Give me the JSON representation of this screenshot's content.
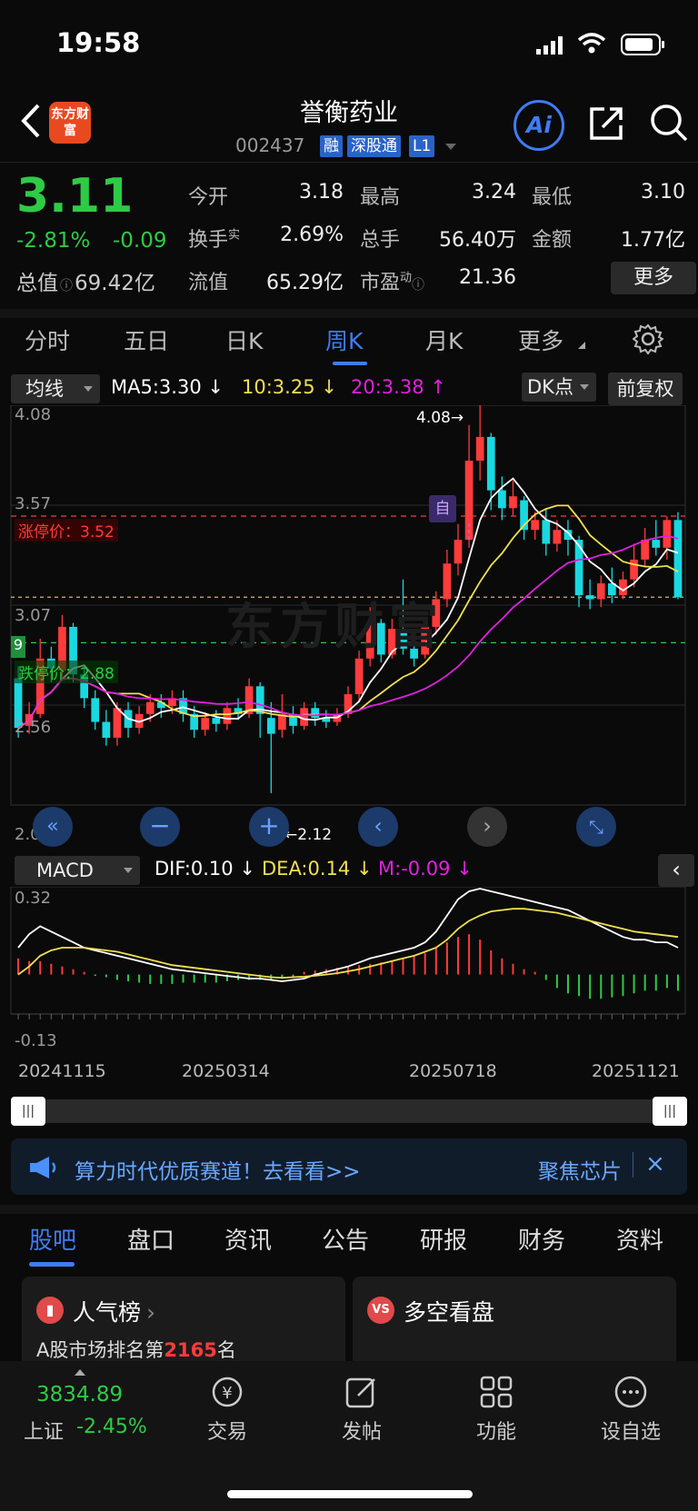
{
  "status_bar": {
    "time": "19:58"
  },
  "header": {
    "app_logo": "东方财富",
    "stock_name": "誉衡药业",
    "stock_code": "002437",
    "tags": [
      "融",
      "深股通",
      "L1"
    ],
    "ai_label": "Ai"
  },
  "quote": {
    "price": "3.11",
    "pct_change": "-2.81%",
    "change": "-0.09",
    "total_value_label": "总值",
    "total_value": "69.42亿",
    "fields": [
      {
        "label": "今开",
        "value": "3.18",
        "color": "green"
      },
      {
        "label": "最高",
        "value": "3.24",
        "color": "red"
      },
      {
        "label": "最低",
        "value": "3.10",
        "color": "green"
      },
      {
        "label": "换手",
        "sup": "实",
        "value": "2.69%",
        "color": "white"
      },
      {
        "label": "总手",
        "value": "56.40万",
        "color": "white"
      },
      {
        "label": "金额",
        "value": "1.77亿",
        "color": "white"
      },
      {
        "label": "流值",
        "value": "65.29亿",
        "color": "white"
      },
      {
        "label": "市盈",
        "sup": "动",
        "value": "21.36",
        "color": "white"
      }
    ],
    "more_button": "更多"
  },
  "period_tabs": [
    "分时",
    "五日",
    "日K",
    "周K",
    "月K",
    "更多"
  ],
  "active_period": "周K",
  "chart_toolbar": {
    "indicator_dropdown": "均线",
    "ma5": "MA5:3.30",
    "ma10": "10:3.25",
    "ma20": "20:3.38",
    "dk_button": "DK点",
    "adjust_button": "前复权"
  },
  "kline": {
    "y_labels": [
      "4.08",
      "3.57",
      "3.07",
      "2.56",
      "2.06"
    ],
    "limit_up_label": "涨停价：3.52",
    "limit_down_label": "跌停价：2.88",
    "high_marker": "4.08→",
    "low_marker": "←2.12",
    "event_marker": "自",
    "watermark": "东方财富",
    "left_badge": "9"
  },
  "macd_toolbar": {
    "indicator_dropdown": "MACD",
    "dif": "DIF:0.10",
    "dea": "DEA:0.14",
    "m": "M:-0.09"
  },
  "macd": {
    "y_labels": [
      "0.32",
      "-0.13"
    ]
  },
  "x_dates": [
    "20241115",
    "20250314",
    "20250718",
    "20251121"
  ],
  "chart_data": {
    "type": "candlestick",
    "period": "weekly",
    "ylim": [
      2.06,
      4.08
    ],
    "limit_up": 3.52,
    "limit_down": 2.88,
    "candles": [
      [
        2.7,
        2.45,
        2.76,
        2.4
      ],
      [
        2.46,
        2.52,
        2.58,
        2.42
      ],
      [
        2.52,
        2.8,
        2.9,
        2.5
      ],
      [
        2.8,
        2.75,
        2.86,
        2.68
      ],
      [
        2.74,
        2.96,
        3.02,
        2.7
      ],
      [
        2.96,
        2.72,
        2.98,
        2.68
      ],
      [
        2.72,
        2.6,
        2.76,
        2.55
      ],
      [
        2.6,
        2.48,
        2.64,
        2.44
      ],
      [
        2.48,
        2.4,
        2.54,
        2.36
      ],
      [
        2.4,
        2.55,
        2.58,
        2.36
      ],
      [
        2.54,
        2.45,
        2.58,
        2.4
      ],
      [
        2.45,
        2.52,
        2.56,
        2.42
      ],
      [
        2.52,
        2.58,
        2.62,
        2.48
      ],
      [
        2.58,
        2.55,
        2.62,
        2.5
      ],
      [
        2.56,
        2.6,
        2.64,
        2.52
      ],
      [
        2.6,
        2.52,
        2.64,
        2.48
      ],
      [
        2.52,
        2.44,
        2.56,
        2.4
      ],
      [
        2.44,
        2.5,
        2.53,
        2.41
      ],
      [
        2.5,
        2.47,
        2.54,
        2.43
      ],
      [
        2.47,
        2.55,
        2.58,
        2.44
      ],
      [
        2.55,
        2.52,
        2.6,
        2.49
      ],
      [
        2.52,
        2.66,
        2.7,
        2.5
      ],
      [
        2.66,
        2.52,
        2.68,
        2.4
      ],
      [
        2.5,
        2.42,
        2.58,
        2.12
      ],
      [
        2.44,
        2.52,
        2.62,
        2.4
      ],
      [
        2.52,
        2.46,
        2.56,
        2.42
      ],
      [
        2.46,
        2.55,
        2.58,
        2.44
      ],
      [
        2.55,
        2.5,
        2.58,
        2.46
      ],
      [
        2.5,
        2.48,
        2.54,
        2.45
      ],
      [
        2.48,
        2.52,
        2.55,
        2.46
      ],
      [
        2.52,
        2.62,
        2.66,
        2.5
      ],
      [
        2.62,
        2.8,
        2.84,
        2.58
      ],
      [
        2.8,
        2.98,
        3.06,
        2.76
      ],
      [
        2.98,
        2.82,
        3.0,
        2.78
      ],
      [
        2.82,
        2.95,
        3.0,
        2.8
      ],
      [
        2.95,
        2.85,
        3.2,
        2.82
      ],
      [
        2.85,
        2.8,
        2.92,
        2.76
      ],
      [
        2.82,
        2.96,
        3.0,
        2.8
      ],
      [
        2.96,
        3.1,
        3.14,
        2.92
      ],
      [
        3.1,
        3.28,
        3.35,
        3.06
      ],
      [
        3.28,
        3.4,
        3.48,
        3.22
      ],
      [
        3.4,
        3.8,
        3.98,
        3.36
      ],
      [
        3.8,
        3.92,
        4.08,
        3.7
      ],
      [
        3.92,
        3.65,
        3.94,
        3.55
      ],
      [
        3.65,
        3.56,
        3.72,
        3.5
      ],
      [
        3.56,
        3.62,
        3.7,
        3.52
      ],
      [
        3.6,
        3.45,
        3.62,
        3.4
      ],
      [
        3.45,
        3.5,
        3.54,
        3.4
      ],
      [
        3.5,
        3.38,
        3.56,
        3.32
      ],
      [
        3.38,
        3.45,
        3.5,
        3.34
      ],
      [
        3.45,
        3.4,
        3.5,
        3.32
      ],
      [
        3.4,
        3.12,
        3.42,
        3.06
      ],
      [
        3.12,
        3.1,
        3.2,
        3.05
      ],
      [
        3.1,
        3.18,
        3.22,
        3.06
      ],
      [
        3.18,
        3.12,
        3.26,
        3.08
      ],
      [
        3.12,
        3.2,
        3.24,
        3.1
      ],
      [
        3.2,
        3.3,
        3.38,
        3.16
      ],
      [
        3.3,
        3.4,
        3.46,
        3.26
      ],
      [
        3.4,
        3.36,
        3.5,
        3.32
      ],
      [
        3.36,
        3.5,
        3.52,
        3.3
      ],
      [
        3.5,
        3.11,
        3.54,
        3.1
      ]
    ],
    "macd_hist": [
      0.06,
      0.05,
      0.05,
      0.04,
      0.03,
      0.02,
      0.01,
      -0.005,
      -0.01,
      -0.02,
      -0.025,
      -0.03,
      -0.035,
      -0.035,
      -0.035,
      -0.03,
      -0.03,
      -0.03,
      -0.03,
      -0.025,
      -0.02,
      -0.02,
      -0.02,
      -0.02,
      -0.015,
      -0.01,
      0.01,
      0.015,
      0.02,
      0.025,
      0.03,
      0.035,
      0.04,
      0.045,
      0.05,
      0.06,
      0.07,
      0.08,
      0.1,
      0.12,
      0.14,
      0.15,
      0.13,
      0.09,
      0.06,
      0.04,
      0.02,
      0.01,
      -0.02,
      -0.05,
      -0.07,
      -0.08,
      -0.09,
      -0.09,
      -0.085,
      -0.08,
      -0.07,
      -0.06,
      -0.06,
      -0.05,
      -0.06
    ],
    "macd_dif": [
      0.1,
      0.15,
      0.18,
      0.16,
      0.14,
      0.12,
      0.1,
      0.09,
      0.08,
      0.07,
      0.06,
      0.05,
      0.04,
      0.03,
      0.02,
      0.015,
      0.01,
      0.005,
      0.0,
      -0.005,
      -0.01,
      -0.015,
      -0.015,
      -0.02,
      -0.025,
      -0.02,
      -0.015,
      0.0,
      0.01,
      0.02,
      0.03,
      0.045,
      0.06,
      0.07,
      0.08,
      0.09,
      0.1,
      0.12,
      0.16,
      0.22,
      0.28,
      0.31,
      0.32,
      0.31,
      0.3,
      0.29,
      0.28,
      0.27,
      0.26,
      0.25,
      0.24,
      0.22,
      0.2,
      0.18,
      0.16,
      0.14,
      0.13,
      0.13,
      0.12,
      0.12,
      0.1
    ],
    "macd_dea": [
      0.0,
      0.03,
      0.07,
      0.09,
      0.1,
      0.1,
      0.1,
      0.095,
      0.09,
      0.085,
      0.075,
      0.065,
      0.055,
      0.045,
      0.035,
      0.03,
      0.025,
      0.02,
      0.015,
      0.01,
      0.005,
      0.0,
      -0.005,
      -0.01,
      -0.012,
      -0.01,
      -0.008,
      -0.004,
      0.0,
      0.005,
      0.012,
      0.02,
      0.03,
      0.04,
      0.05,
      0.06,
      0.07,
      0.085,
      0.1,
      0.13,
      0.17,
      0.2,
      0.22,
      0.235,
      0.24,
      0.245,
      0.245,
      0.24,
      0.235,
      0.23,
      0.22,
      0.21,
      0.2,
      0.19,
      0.18,
      0.17,
      0.16,
      0.155,
      0.15,
      0.145,
      0.14
    ],
    "macd_ylim": [
      -0.13,
      0.32
    ]
  },
  "bottom_banner": {
    "text": "算力时代优质赛道！去看看>>",
    "right_text": "聚焦芯片"
  },
  "bottom_tabs": [
    "股吧",
    "盘口",
    "资讯",
    "公告",
    "研报",
    "财务",
    "资料"
  ],
  "cards": [
    {
      "title": "人气榜",
      "line_prefix": "A股市场排名第",
      "line_rank": "2165",
      "line_suffix": "名"
    },
    {
      "title": "多空看盘"
    }
  ],
  "bottom_nav": {
    "index_value": "3834.89",
    "index_label": "上证",
    "index_change": "-2.45%",
    "items": [
      "交易",
      "发帖",
      "功能",
      "设自选"
    ]
  },
  "colors": {
    "up": "#ff3b3b",
    "down": "#19d8e0",
    "accent": "#3f7cf4",
    "ma5": "#ffffff",
    "ma10": "#f0e050",
    "ma20": "#e020e0"
  }
}
